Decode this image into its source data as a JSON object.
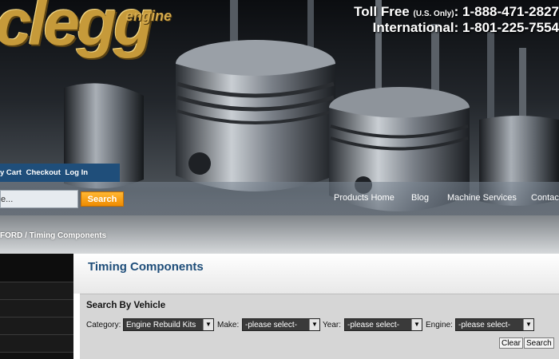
{
  "brand": {
    "logo": "clegg",
    "logo_sub": "engine"
  },
  "contact": {
    "toll_free_label": "Toll Free",
    "toll_free_note": "(U.S. Only)",
    "toll_free_number": ": 1-888-471-2827",
    "intl_label": "International",
    "intl_number": ": 1-801-225-7554"
  },
  "account_bar": {
    "items": [
      "y Cart",
      "Checkout",
      "Log In"
    ]
  },
  "search": {
    "input_value": "e...",
    "button_label": "Search"
  },
  "nav": {
    "items": [
      "Products Home",
      "Blog",
      "Machine Services",
      "Contact"
    ]
  },
  "breadcrumb": {
    "parent": "FORD",
    "separator": " / ",
    "current": "Timing Components"
  },
  "content": {
    "page_title": "Timing Components"
  },
  "vehicle_search": {
    "title": "Search By Vehicle",
    "category_label": "Category:",
    "category_value": "Engine Rebuild Kits",
    "make_label": "Make:",
    "make_value": "-please select-",
    "year_label": "Year:",
    "year_value": "-please select-",
    "engine_label": "Engine:",
    "engine_value": "-please select-",
    "clear_label": "Clear",
    "search_label": "Search"
  },
  "colors": {
    "brand_blue": "#1f4e7a",
    "accent_orange": "#f08c00",
    "logo_gold": "#c69a3a"
  },
  "icons": {
    "dropdown": "chevron-down-icon"
  }
}
